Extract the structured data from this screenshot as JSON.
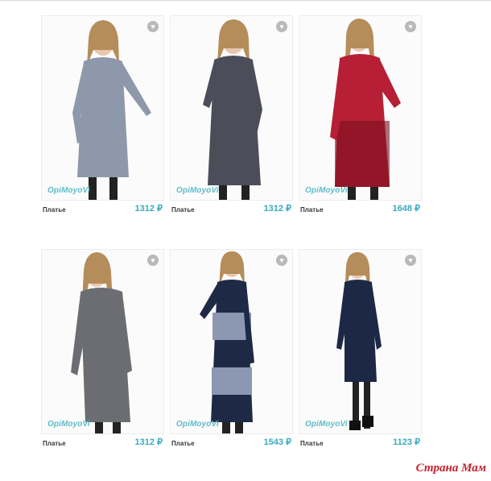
{
  "products": [
    {
      "name": "Платье",
      "price": "1312 ₽",
      "brand": "OpiMoyoVi",
      "fav_icon": "heart-icon"
    },
    {
      "name": "Платье",
      "price": "1312 ₽",
      "brand": "OpiMoyoVi",
      "fav_icon": "heart-icon"
    },
    {
      "name": "Платье",
      "price": "1648 ₽",
      "brand": "OpiMoyoVi",
      "fav_icon": "heart-icon"
    },
    {
      "name": "Платье",
      "price": "1312 ₽",
      "brand": "OpiMoyoVi",
      "fav_icon": "heart-icon"
    },
    {
      "name": "Платье",
      "price": "1543 ₽",
      "brand": "OpiMoyoVi",
      "fav_icon": "heart-icon"
    },
    {
      "name": "Платье",
      "price": "1123 ₽",
      "brand": "OpiMoyoVi",
      "fav_icon": "heart-icon"
    }
  ],
  "watermark": "Страна Мам",
  "colors": {
    "price": "#3aa9c0",
    "brand": "#5fbcc8",
    "fav_badge": "#b9b9b9",
    "watermark": "#c41f2d",
    "dress_1": "#8e98ab",
    "dress_2": "#4b4e59",
    "dress_3": "#b61f35",
    "dress_4": "#6b6d72",
    "dress_5": "#1e2a45",
    "dress_6": "#1d2846"
  }
}
